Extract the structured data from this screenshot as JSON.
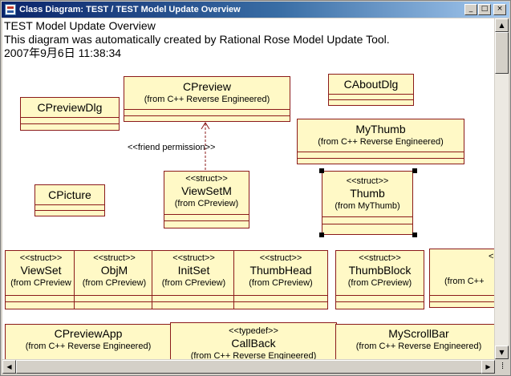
{
  "window": {
    "title": "Class Diagram: TEST / TEST Model Update Overview",
    "controls": {
      "minimize": "_",
      "maximize": "□",
      "close": "×"
    }
  },
  "diagram": {
    "header": {
      "title": "TEST Model Update Overview",
      "description": "This diagram was automatically created by Rational Rose Model Update Tool.",
      "timestamp": "2007年9月6日 11:38:34"
    },
    "classes": {
      "cpreviewdlg": {
        "name": "CPreviewDlg"
      },
      "cpreview": {
        "name": "CPreview",
        "from": "(from C++ Reverse Engineered)"
      },
      "caboutdlg": {
        "name": "CAboutDlg"
      },
      "mythumb": {
        "name": "MyThumb",
        "from": "(from C++ Reverse Engineered)"
      },
      "cpicture": {
        "name": "CPicture"
      },
      "viewsetm": {
        "stereotype": "<<struct>>",
        "name": "ViewSetM",
        "from": "(from CPreview)"
      },
      "thumb": {
        "stereotype": "<<struct>>",
        "name": "Thumb",
        "from": "(from MyThumb)"
      },
      "viewset": {
        "stereotype": "<<struct>>",
        "name": "ViewSet",
        "from": "(from CPreview"
      },
      "objm": {
        "stereotype": "<<struct>>",
        "name": "ObjM",
        "from": "(from CPreview)"
      },
      "initset": {
        "stereotype": "<<struct>>",
        "name": "InitSet",
        "from": "(from CPreview)"
      },
      "thumbhead": {
        "stereotype": "<<struct>>",
        "name": "ThumbHead",
        "from": "(from CPreview)"
      },
      "thumbblock": {
        "stereotype": "<<struct>>",
        "name": "ThumbBlock",
        "from": "(from CPreview)"
      },
      "partial": {
        "stereotype": "<<",
        "from": "(from C++"
      },
      "cpreviewapp": {
        "name": "CPreviewApp",
        "from": "(from C++ Reverse Engineered)"
      },
      "callback": {
        "stereotype": "<<typedef>>",
        "name": "CallBack",
        "from": "(from C++ Reverse Engineered)"
      },
      "myscrollbar": {
        "name": "MyScrollBar",
        "from": "(from C++ Reverse Engineered)"
      }
    },
    "dependency": {
      "label": "<<friend permission>>"
    }
  },
  "scrollbars": {
    "up": "▲",
    "down": "▼",
    "left": "◀",
    "right": "▶",
    "vertical_position": 0.0,
    "horizontal_position": 0.0
  },
  "size_grip": "⁞"
}
